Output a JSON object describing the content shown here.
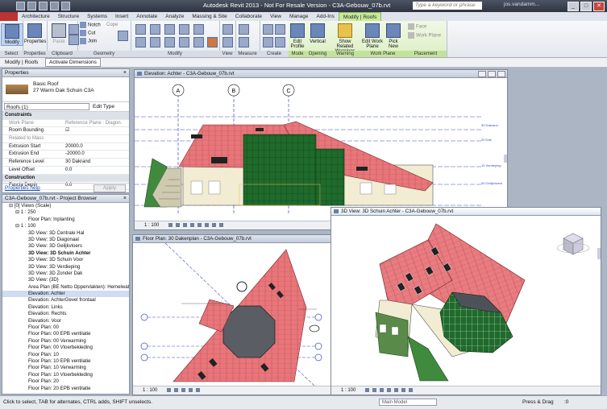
{
  "titlebar": {
    "title": "Autodesk Revit 2013 - Not For Resale Version -    C3A-Gebouw_07b.rvt",
    "search_placeholder": "Type a keyword or phrase",
    "user": "jos.vandamm...",
    "min": "_",
    "max": "□",
    "close": "✕"
  },
  "tabs": [
    "Architecture",
    "Structure",
    "Systems",
    "Insert",
    "Annotate",
    "Analyze",
    "Massing & Site",
    "Collaborate",
    "View",
    "Manage",
    "Add-Ins",
    "Modify | Roofs"
  ],
  "ribbon": {
    "modify": "Modify",
    "properties": "Properties",
    "paste": "Paste",
    "cope": "Cope",
    "cut": "Cut",
    "join": "Join",
    "notch": "Notch",
    "panels": [
      "Select",
      "Properties",
      "Clipboard",
      "Geometry",
      "Modify",
      "View",
      "Measure",
      "Create",
      "Mode",
      "Opening",
      "Warning",
      "Work Plane",
      "Placement"
    ],
    "edit_profile": "Edit Profile",
    "vertical": "Vertical",
    "show_related": "Show Related Warnings",
    "edit_work_plane": "Edit Work Plane",
    "pick_new": "Pick New",
    "face": "Face",
    "work_plane": "Work Plane"
  },
  "context": {
    "label": "Modify | Roofs",
    "active_tab": "Activate Dimensions"
  },
  "properties": {
    "header": "Properties",
    "type_line1": "Basic Roof",
    "type_line2": "27 Warm Dak Schuin C3A",
    "selector": "Roofs (1)",
    "edit_type": "Edit Type",
    "rows": [
      {
        "name": "Constraints",
        "value": "",
        "group": true
      },
      {
        "name": "Work Plane",
        "value": "Reference Plane : Diagon...",
        "disabled": true
      },
      {
        "name": "Room Bounding",
        "value": "☑"
      },
      {
        "name": "Related to Mass",
        "value": "",
        "disabled": true
      },
      {
        "name": "Extrusion Start",
        "value": "20000.0"
      },
      {
        "name": "Extrusion End",
        "value": "-20000.0"
      },
      {
        "name": "Reference Level",
        "value": "30 Dakrand"
      },
      {
        "name": "Level Offset",
        "value": "0.0"
      },
      {
        "name": "Construction",
        "value": "",
        "group": true
      },
      {
        "name": "Fascia Depth",
        "value": "0.0"
      }
    ],
    "help": "Properties help",
    "apply": "Apply"
  },
  "browser": {
    "header": "C3A-Gebouw_07b.rvt - Project Browser",
    "items": [
      {
        "t": "⊟ [0] Views (Scale)",
        "i": 1
      },
      {
        "t": "⊟ 1 : 250",
        "i": 2
      },
      {
        "t": "Floor Plan: Inplanting",
        "i": 4
      },
      {
        "t": "⊟ 1 : 100",
        "i": 2
      },
      {
        "t": "3D View: 3D Centrale Hal",
        "i": 4
      },
      {
        "t": "3D View: 3D Diagonaal",
        "i": 4
      },
      {
        "t": "3D View: 3D Gelijkvloers",
        "i": 4
      },
      {
        "t": "3D View: 3D Schuin Achter",
        "i": 4,
        "bold": true
      },
      {
        "t": "3D View: 3D Schuin Voor",
        "i": 4
      },
      {
        "t": "3D View: 3D Verdieping",
        "i": 4
      },
      {
        "t": "3D View: 3D Zonder Dak",
        "i": 4
      },
      {
        "t": "3D View: {3D}",
        "i": 4
      },
      {
        "t": "Area Plan (BE Netto Oppervlakten): Hemelwat",
        "i": 4
      },
      {
        "t": "Elevation: Achter",
        "i": 4,
        "sel": true
      },
      {
        "t": "Elevation: AchterGevel frontaal",
        "i": 4
      },
      {
        "t": "Elevation: Links",
        "i": 4
      },
      {
        "t": "Elevation: Rechts",
        "i": 4
      },
      {
        "t": "Elevation: Voor",
        "i": 4
      },
      {
        "t": "Floor Plan: 00",
        "i": 4
      },
      {
        "t": "Floor Plan: 00 EPB ventilatie",
        "i": 4
      },
      {
        "t": "Floor Plan: 00 Verwarming",
        "i": 4
      },
      {
        "t": "Floor Plan: 00 Vloerbekleding",
        "i": 4
      },
      {
        "t": "Floor Plan: 10",
        "i": 4
      },
      {
        "t": "Floor Plan: 10 EPB ventilatie",
        "i": 4
      },
      {
        "t": "Floor Plan: 10 Verwarming",
        "i": 4
      },
      {
        "t": "Floor Plan: 10 Vloerbekleding",
        "i": 4
      },
      {
        "t": "Floor Plan: 20",
        "i": 4
      },
      {
        "t": "Floor Plan: 20 EPB ventilatie",
        "i": 4
      }
    ]
  },
  "views": {
    "elevation": {
      "title": "Elevation: Achter - C3A-Gebouw_07b.rvt",
      "scale": "1 : 100",
      "grids": [
        "A",
        "B",
        "C"
      ],
      "levels": [
        "30 Dakrand",
        "20 Dak",
        "10 Verdieping",
        "00 Gelijkvloers"
      ]
    },
    "floorplan": {
      "title": "Floor Plan: 30 Dakenplan - C3A-Gebouw_07b.rvt",
      "scale": "1 : 100"
    },
    "threed": {
      "title": "3D View: 3D Schuin Achter - C3A-Gebouw_07b.rvt",
      "scale": "1 : 100"
    }
  },
  "status": {
    "text": "Click to select, TAB for alternates, CTRL adds, SHIFT unselects.",
    "model": "Main Model",
    "press_drag": "Press & Drag",
    "filter_count": ":0"
  },
  "colors": {
    "roof": "#e8767a",
    "glass": "#1f6a2c",
    "wall": "#f1ecd2",
    "selection": "#3b4ec4"
  }
}
